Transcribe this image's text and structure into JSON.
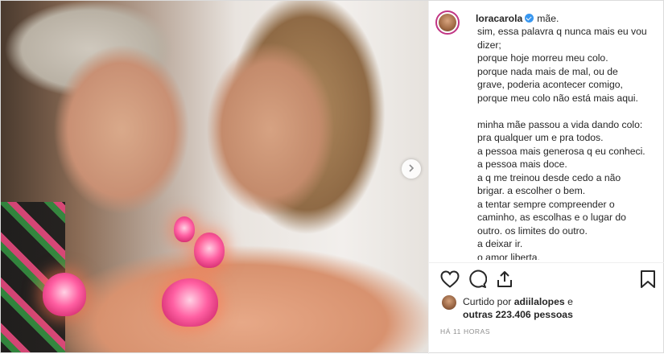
{
  "post": {
    "author": {
      "username": "loracarola"
    },
    "caption_first": "mãe.",
    "caption_lines": [
      "sim, essa palavra q nunca mais eu vou",
      "dizer;",
      "porque hoje morreu meu colo.",
      "porque nada mais de mal, ou de",
      "grave, poderia acontecer comigo,",
      "porque meu colo não está mais aqui.",
      "",
      "minha mãe passou a vida dando colo:",
      "pra qualquer um e pra todos.",
      "a pessoa mais generosa q eu conheci.",
      "a pessoa mais doce.",
      "a q me treinou desde cedo a não",
      "brigar. a escolher o bem.",
      "a tentar sempre compreender o",
      "caminho, as escolhas e o lugar do",
      "outro. os limites do outro.",
      "a deixar ir.",
      "o amor liberta."
    ],
    "likes": {
      "prefix": "Curtido por",
      "user": "adiilalopes",
      "joiner": "e",
      "others": "outras 223.406 pessoas"
    },
    "timestamp": "HÁ 11 HORAS"
  },
  "icons": {
    "like": "heart-icon",
    "comment": "comment-icon",
    "share": "share-icon",
    "save": "bookmark-icon",
    "next": "chevron-right-icon",
    "verified": "verified-badge-icon"
  },
  "colors": {
    "verified": "#3897f0",
    "text": "#262626",
    "muted": "#8e8e8e"
  }
}
